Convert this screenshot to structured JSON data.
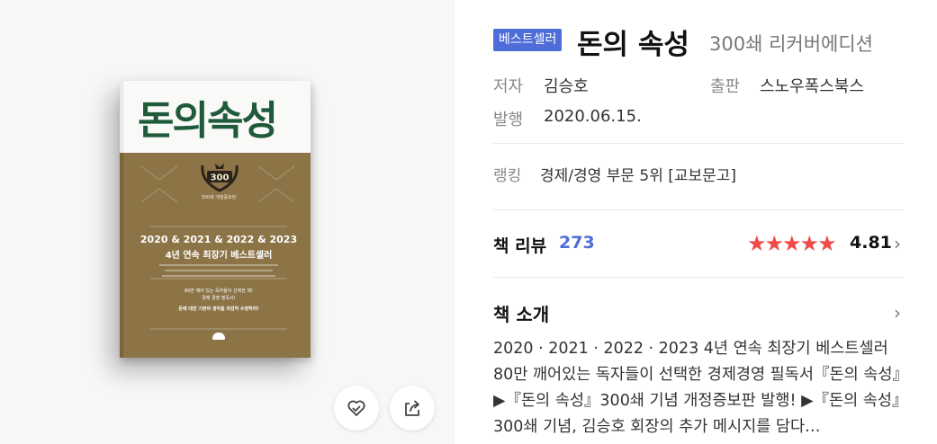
{
  "cover": {
    "title": "돈의속성",
    "badge": "300",
    "badge_sub": "300쇄 개정증보판",
    "line1": "2020 & 2021 & 2022 & 2023",
    "line2": "4년 연속 최장기 베스트셀러",
    "small1": "80만 깨어 있는 독자들이 선택한 책!",
    "small2": "경제 경영 필독서!",
    "small3": "돈에 대한 기본의 생각을 과감히 수정하라!"
  },
  "product": {
    "tag": "베스트셀러",
    "title": "돈의 속성",
    "edition": "300쇄 리커버에디션",
    "author_label": "저자",
    "author": "김승호",
    "publisher_label": "출판",
    "publisher": "스노우폭스북스",
    "date_label": "발행",
    "date": "2020.06.15.",
    "ranking_label": "랭킹",
    "ranking": "경제/경영 부문 5위 [교보문고]"
  },
  "review": {
    "label": "책 리뷰",
    "count": "273",
    "rating": "4.81",
    "stars": 5
  },
  "intro": {
    "label": "책 소개",
    "text": "2020 · 2021 · 2022 · 2023 4년 연속 최장기 베스트셀러 80만 깨어있는 독자들이 선택한 경제경영 필독서『돈의 속성』▶『돈의 속성』300쇄 기념 개정증보판 발행! ▶『돈의 속성』300쇄 기념, 김승호 회장의 추가 메시지를 담다…"
  },
  "icons": {
    "like": "heart-check-icon",
    "share": "share-icon",
    "chevron": "chevron-right-icon",
    "star": "star-icon"
  },
  "colors": {
    "accent": "#4f6dd8",
    "star": "#ef4b4b",
    "cover_green": "#1f5a3b",
    "cover_gold": "#8c7447"
  }
}
